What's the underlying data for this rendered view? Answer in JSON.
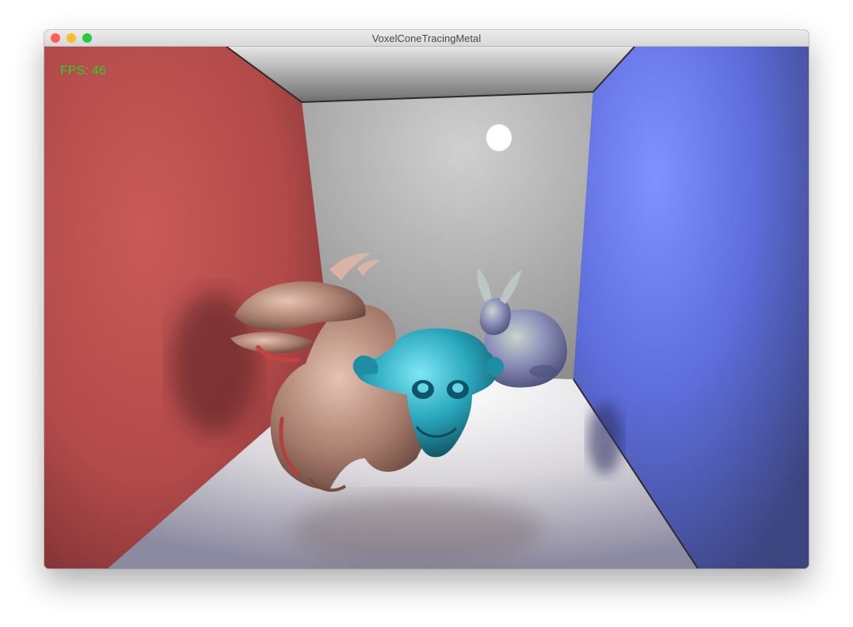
{
  "window": {
    "title": "VoxelConeTracingMetal",
    "traffic_lights": {
      "close": "#ff5f57",
      "minimize": "#febc2e",
      "zoom": "#28c840"
    }
  },
  "overlay": {
    "fps_text": "FPS: 46",
    "fps_color": "#2bd12b"
  },
  "scene": {
    "left_wall_color": "#c0504f",
    "right_wall_color": "#5d6fe0",
    "back_wall_color": "#bdbdbd",
    "ceiling_color": "#8c8c8c",
    "floor_color": "#d8d8d8",
    "light_color": "#ffffff",
    "objects": [
      {
        "name": "dragon",
        "color": "#b98f7f"
      },
      {
        "name": "monkey-head",
        "color": "#2aa8be"
      },
      {
        "name": "bunny",
        "color": "#8c8fb8"
      }
    ]
  }
}
